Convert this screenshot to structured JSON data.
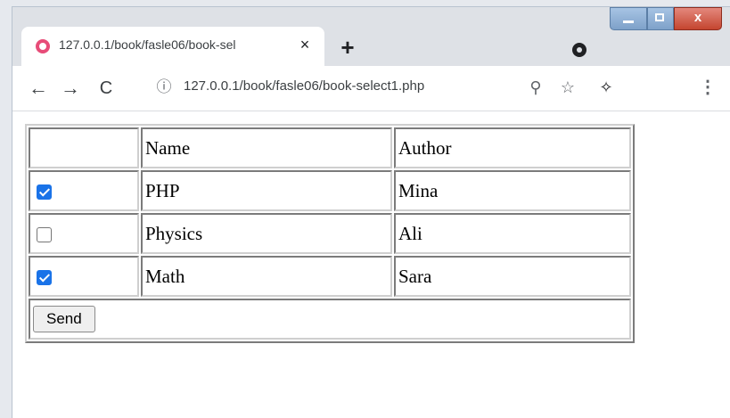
{
  "browser": {
    "tab_title": "127.0.0.1/book/fasle06/book-sel",
    "tab_close": "×",
    "new_tab": "+",
    "url": "127.0.0.1/book/fasle06/book-select1.php",
    "window_close": "x"
  },
  "icons": {
    "back": "back-arrow-icon",
    "forward": "forward-arrow-icon",
    "reload": "reload-icon",
    "info": "info-icon",
    "zoom": "zoom-icon",
    "star": "star-icon",
    "extensions": "puzzle-icon",
    "menu": "kebab-menu-icon"
  },
  "table": {
    "headers": [
      "",
      "Name",
      "Author"
    ],
    "rows": [
      {
        "checked": true,
        "name": "PHP",
        "author": "Mina"
      },
      {
        "checked": false,
        "name": "Physics",
        "author": "Ali"
      },
      {
        "checked": true,
        "name": "Math",
        "author": "Sara"
      }
    ],
    "send_label": "Send"
  },
  "colors": {
    "checkbox_checked": "#1a73e8",
    "favicon": "#e74c78"
  }
}
